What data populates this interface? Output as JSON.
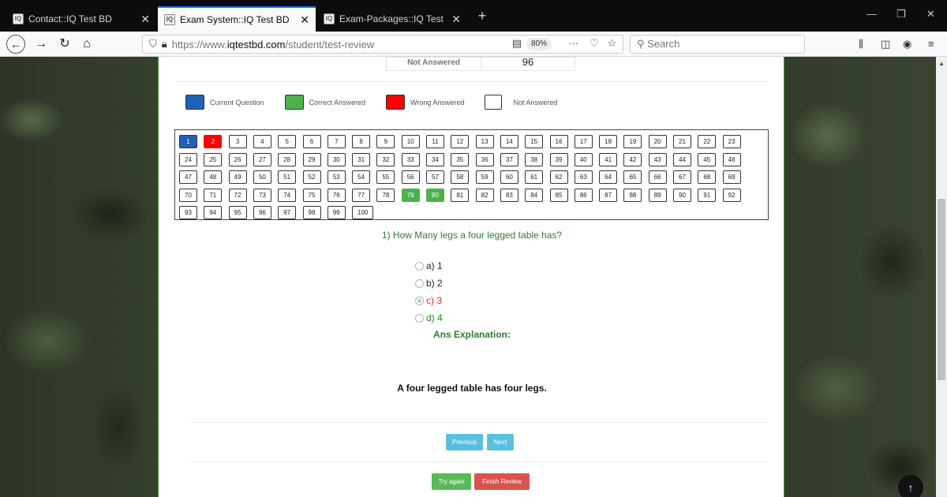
{
  "browser": {
    "tabs": [
      {
        "title": "Contact::IQ Test BD",
        "close": "✕"
      },
      {
        "title": "Exam System::IQ Test BD",
        "close": "✕"
      },
      {
        "title": "Exam-Packages::IQ Test BD",
        "close": "✕"
      }
    ],
    "new_tab": "+",
    "url_prefix": "https://www.",
    "url_host": "iqtestbd.com",
    "url_path": "/student/test-review",
    "zoom": "80%",
    "search_placeholder": "Search"
  },
  "summary": {
    "label": "Not Answered",
    "value": "96"
  },
  "legend": [
    {
      "label": "Current Question",
      "color": "#2160b8"
    },
    {
      "label": "Correct Answered",
      "color": "#4cb34c"
    },
    {
      "label": "Wrong Answered",
      "color": "#ff0000"
    },
    {
      "label": "Not Answered",
      "color": "#ffffff"
    }
  ],
  "question_grid": {
    "total": 100,
    "current": [
      1
    ],
    "correct": [
      79,
      80
    ],
    "wrong": [
      2
    ]
  },
  "question": {
    "text": "1) How Many legs a four legged table has?",
    "options": [
      {
        "label": "a) 1",
        "state": "normal"
      },
      {
        "label": "b) 2",
        "state": "normal"
      },
      {
        "label": "c) 3",
        "state": "wrong"
      },
      {
        "label": "d) 4",
        "state": "correct"
      }
    ]
  },
  "explanation": {
    "heading": "Ans Explanation:",
    "text": "A four legged table has four legs."
  },
  "buttons": {
    "previous": "Previous",
    "next": "Next",
    "try_again": "Try again",
    "finish": "Finish Review"
  },
  "colors": {
    "current": "#2160b8",
    "correct": "#4cb34c",
    "wrong": "#ff0000"
  }
}
